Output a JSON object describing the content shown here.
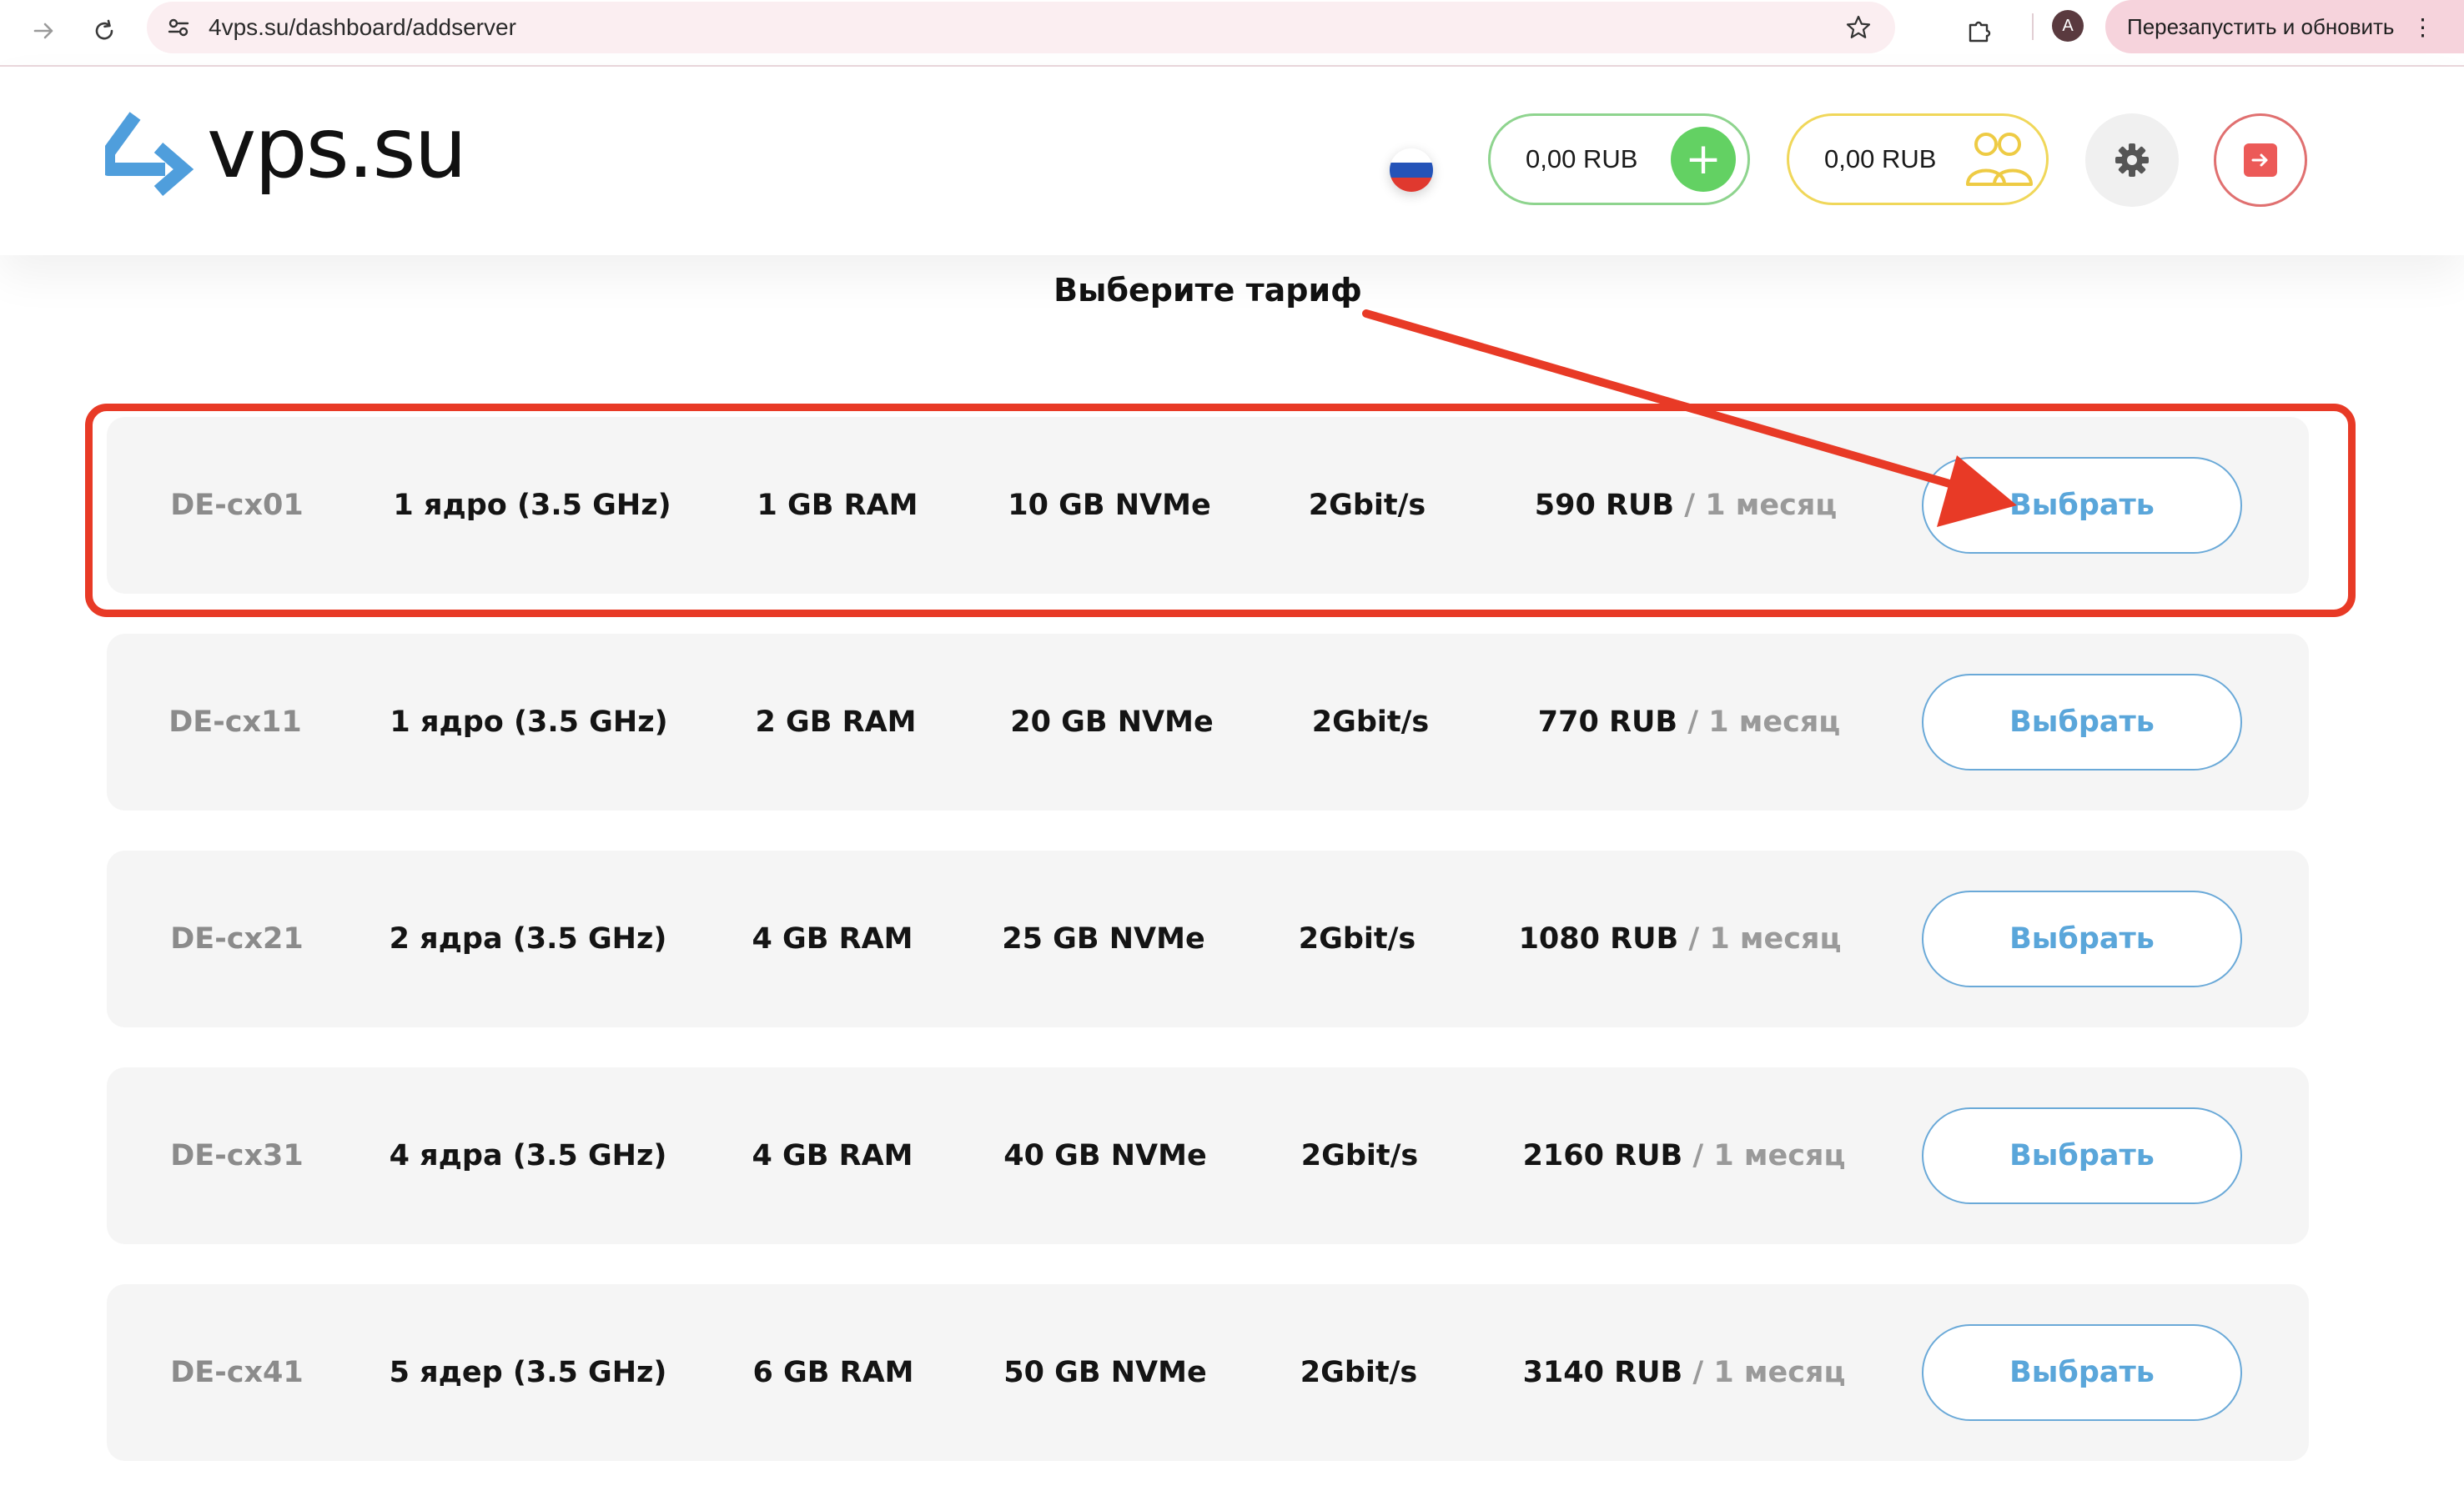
{
  "browser": {
    "url": "4vps.su/dashboard/addserver",
    "profile_initial": "A",
    "relaunch_label": "Перезапустить и обновить",
    "menu_glyph": "⋮"
  },
  "header": {
    "logo_text": "vps.su",
    "language": "ru",
    "balance": {
      "amount": "0,00 RUB",
      "add_glyph": "+"
    },
    "referral_balance": {
      "amount": "0,00 RUB"
    },
    "icons": [
      "settings-icon",
      "logout-icon",
      "people-icon",
      "plus-icon",
      "russia-flag-icon"
    ],
    "colors": {
      "balance_border": "#8ed48e",
      "referral_border": "#f0d75a",
      "add_button": "#63d163",
      "logout": "#ec5a58"
    }
  },
  "page": {
    "title": "Выберите тариф"
  },
  "tariffs": [
    {
      "code": "DE-cx01",
      "cpu": "1 ядро (3.5 GHz)",
      "ram": "1 GB RAM",
      "disk": "10 GB NVMe",
      "network": "2Gbit/s",
      "price": "590 RUB",
      "period": " / 1 месяц",
      "button": "Выбрать",
      "highlighted": true
    },
    {
      "code": "DE-cx11",
      "cpu": "1 ядро (3.5 GHz)",
      "ram": "2 GB RAM",
      "disk": "20 GB NVMe",
      "network": "2Gbit/s",
      "price": "770 RUB",
      "period": " / 1 месяц",
      "button": "Выбрать"
    },
    {
      "code": "DE-cx21",
      "cpu": "2 ядра (3.5 GHz)",
      "ram": "4 GB RAM",
      "disk": "25 GB NVMe",
      "network": "2Gbit/s",
      "price": "1080 RUB",
      "period": " / 1 месяц",
      "button": "Выбрать"
    },
    {
      "code": "DE-cx31",
      "cpu": "4 ядра (3.5 GHz)",
      "ram": "4 GB RAM",
      "disk": "40 GB NVMe",
      "network": "2Gbit/s",
      "price": "2160 RUB",
      "period": " / 1 месяц",
      "button": "Выбрать"
    },
    {
      "code": "DE-cx41",
      "cpu": "5 ядер (3.5 GHz)",
      "ram": "6 GB RAM",
      "disk": "50 GB NVMe",
      "network": "2Gbit/s",
      "price": "3140 RUB",
      "period": " / 1 месяц",
      "button": "Выбрать"
    }
  ],
  "annotation": {
    "color": "#e83a26"
  }
}
